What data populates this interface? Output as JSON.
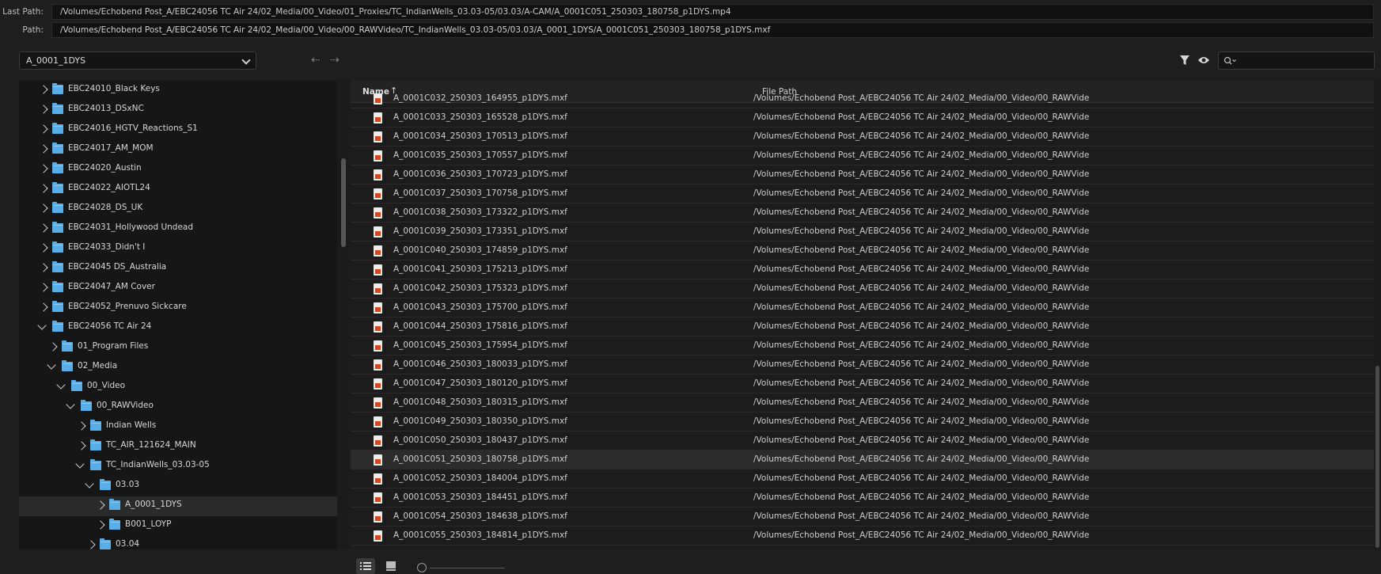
{
  "paths": {
    "last_path_label": "Last Path:",
    "last_path": "/Volumes/Echobend Post_A/EBC24056 TC Air 24/02_Media/00_Video/01_Proxies/TC_IndianWells_03.03-05/03.03/A-CAM/A_0001C051_250303_180758_p1DYS.mp4",
    "path_label": "Path:",
    "path": "/Volumes/Echobend Post_A/EBC24056 TC Air 24/02_Media/00_Video/00_RAWVideo/TC_IndianWells_03.03-05/03.03/A_0001_1DYS/A_0001C051_250303_180758_p1DYS.mxf"
  },
  "toolbar": {
    "dropdown_value": "A_0001_1DYS",
    "back_glyph": "⇠",
    "forward_glyph": "⇢",
    "search_placeholder": "",
    "icons": [
      "filter-icon",
      "eye-icon",
      "search-icon"
    ]
  },
  "tree": {
    "items": [
      {
        "label": "EBC24010_Black Keys",
        "depth": 0,
        "expanded": false
      },
      {
        "label": "EBC24013_DSxNC",
        "depth": 0,
        "expanded": false
      },
      {
        "label": "EBC24016_HGTV_Reactions_S1",
        "depth": 0,
        "expanded": false
      },
      {
        "label": "EBC24017_AM_MOM",
        "depth": 0,
        "expanded": false
      },
      {
        "label": "EBC24020_Austin",
        "depth": 0,
        "expanded": false
      },
      {
        "label": "EBC24022_AIOTL24",
        "depth": 0,
        "expanded": false
      },
      {
        "label": "EBC24028_DS_UK",
        "depth": 0,
        "expanded": false
      },
      {
        "label": "EBC24031_Hollywood Undead",
        "depth": 0,
        "expanded": false
      },
      {
        "label": "EBC24033_Didn't I",
        "depth": 0,
        "expanded": false
      },
      {
        "label": "EBC24045 DS_Australia",
        "depth": 0,
        "expanded": false
      },
      {
        "label": "EBC24047_AM Cover",
        "depth": 0,
        "expanded": false
      },
      {
        "label": "EBC24052_Prenuvo Sickcare",
        "depth": 0,
        "expanded": false
      },
      {
        "label": "EBC24056 TC Air 24",
        "depth": 0,
        "expanded": true
      },
      {
        "label": "01_Program Files",
        "depth": 1,
        "expanded": false
      },
      {
        "label": "02_Media",
        "depth": 1,
        "expanded": true
      },
      {
        "label": "00_Video",
        "depth": 2,
        "expanded": true
      },
      {
        "label": "00_RAWVideo",
        "depth": 3,
        "expanded": true
      },
      {
        "label": "Indian Wells",
        "depth": 4,
        "expanded": false
      },
      {
        "label": "TC_AIR_121624_MAIN",
        "depth": 4,
        "expanded": false
      },
      {
        "label": "TC_IndianWells_03.03-05",
        "depth": 4,
        "expanded": true
      },
      {
        "label": "03.03",
        "depth": 5,
        "expanded": true
      },
      {
        "label": "A_0001_1DYS",
        "depth": 6,
        "expanded": false,
        "selected": true
      },
      {
        "label": "B001_LOYP",
        "depth": 6,
        "expanded": false
      },
      {
        "label": "03.04",
        "depth": 5,
        "expanded": false
      }
    ]
  },
  "list": {
    "col_name": "Name",
    "sort_glyph": "↑",
    "col_path": "File Path",
    "rows": [
      {
        "name": "A_0001C032_250303_164955_p1DYS.mxf",
        "path": "/Volumes/Echobend Post_A/EBC24056 TC Air 24/02_Media/00_Video/00_RAWVide"
      },
      {
        "name": "A_0001C033_250303_165528_p1DYS.mxf",
        "path": "/Volumes/Echobend Post_A/EBC24056 TC Air 24/02_Media/00_Video/00_RAWVide"
      },
      {
        "name": "A_0001C034_250303_170513_p1DYS.mxf",
        "path": "/Volumes/Echobend Post_A/EBC24056 TC Air 24/02_Media/00_Video/00_RAWVide"
      },
      {
        "name": "A_0001C035_250303_170557_p1DYS.mxf",
        "path": "/Volumes/Echobend Post_A/EBC24056 TC Air 24/02_Media/00_Video/00_RAWVide"
      },
      {
        "name": "A_0001C036_250303_170723_p1DYS.mxf",
        "path": "/Volumes/Echobend Post_A/EBC24056 TC Air 24/02_Media/00_Video/00_RAWVide"
      },
      {
        "name": "A_0001C037_250303_170758_p1DYS.mxf",
        "path": "/Volumes/Echobend Post_A/EBC24056 TC Air 24/02_Media/00_Video/00_RAWVide"
      },
      {
        "name": "A_0001C038_250303_173322_p1DYS.mxf",
        "path": "/Volumes/Echobend Post_A/EBC24056 TC Air 24/02_Media/00_Video/00_RAWVide"
      },
      {
        "name": "A_0001C039_250303_173351_p1DYS.mxf",
        "path": "/Volumes/Echobend Post_A/EBC24056 TC Air 24/02_Media/00_Video/00_RAWVide"
      },
      {
        "name": "A_0001C040_250303_174859_p1DYS.mxf",
        "path": "/Volumes/Echobend Post_A/EBC24056 TC Air 24/02_Media/00_Video/00_RAWVide"
      },
      {
        "name": "A_0001C041_250303_175213_p1DYS.mxf",
        "path": "/Volumes/Echobend Post_A/EBC24056 TC Air 24/02_Media/00_Video/00_RAWVide"
      },
      {
        "name": "A_0001C042_250303_175323_p1DYS.mxf",
        "path": "/Volumes/Echobend Post_A/EBC24056 TC Air 24/02_Media/00_Video/00_RAWVide"
      },
      {
        "name": "A_0001C043_250303_175700_p1DYS.mxf",
        "path": "/Volumes/Echobend Post_A/EBC24056 TC Air 24/02_Media/00_Video/00_RAWVide"
      },
      {
        "name": "A_0001C044_250303_175816_p1DYS.mxf",
        "path": "/Volumes/Echobend Post_A/EBC24056 TC Air 24/02_Media/00_Video/00_RAWVide"
      },
      {
        "name": "A_0001C045_250303_175954_p1DYS.mxf",
        "path": "/Volumes/Echobend Post_A/EBC24056 TC Air 24/02_Media/00_Video/00_RAWVide"
      },
      {
        "name": "A_0001C046_250303_180033_p1DYS.mxf",
        "path": "/Volumes/Echobend Post_A/EBC24056 TC Air 24/02_Media/00_Video/00_RAWVide"
      },
      {
        "name": "A_0001C047_250303_180120_p1DYS.mxf",
        "path": "/Volumes/Echobend Post_A/EBC24056 TC Air 24/02_Media/00_Video/00_RAWVide"
      },
      {
        "name": "A_0001C048_250303_180315_p1DYS.mxf",
        "path": "/Volumes/Echobend Post_A/EBC24056 TC Air 24/02_Media/00_Video/00_RAWVide"
      },
      {
        "name": "A_0001C049_250303_180350_p1DYS.mxf",
        "path": "/Volumes/Echobend Post_A/EBC24056 TC Air 24/02_Media/00_Video/00_RAWVide"
      },
      {
        "name": "A_0001C050_250303_180437_p1DYS.mxf",
        "path": "/Volumes/Echobend Post_A/EBC24056 TC Air 24/02_Media/00_Video/00_RAWVide"
      },
      {
        "name": "A_0001C051_250303_180758_p1DYS.mxf",
        "path": "/Volumes/Echobend Post_A/EBC24056 TC Air 24/02_Media/00_Video/00_RAWVide",
        "selected": true
      },
      {
        "name": "A_0001C052_250303_184004_p1DYS.mxf",
        "path": "/Volumes/Echobend Post_A/EBC24056 TC Air 24/02_Media/00_Video/00_RAWVide"
      },
      {
        "name": "A_0001C053_250303_184451_p1DYS.mxf",
        "path": "/Volumes/Echobend Post_A/EBC24056 TC Air 24/02_Media/00_Video/00_RAWVide"
      },
      {
        "name": "A_0001C054_250303_184638_p1DYS.mxf",
        "path": "/Volumes/Echobend Post_A/EBC24056 TC Air 24/02_Media/00_Video/00_RAWVide"
      },
      {
        "name": "A_0001C055_250303_184814_p1DYS.mxf",
        "path": "/Volumes/Echobend Post_A/EBC24056 TC Air 24/02_Media/00_Video/00_RAWVide"
      }
    ]
  },
  "bottom_bar": {
    "icons": [
      "list-view-icon",
      "icon-view-icon"
    ],
    "zoom_level": 0
  },
  "colors": {
    "background": "#1e1e1e",
    "folder": "#5aaee8",
    "file_badge": "#d04a1f",
    "selected_row": "#2b2b2b"
  }
}
